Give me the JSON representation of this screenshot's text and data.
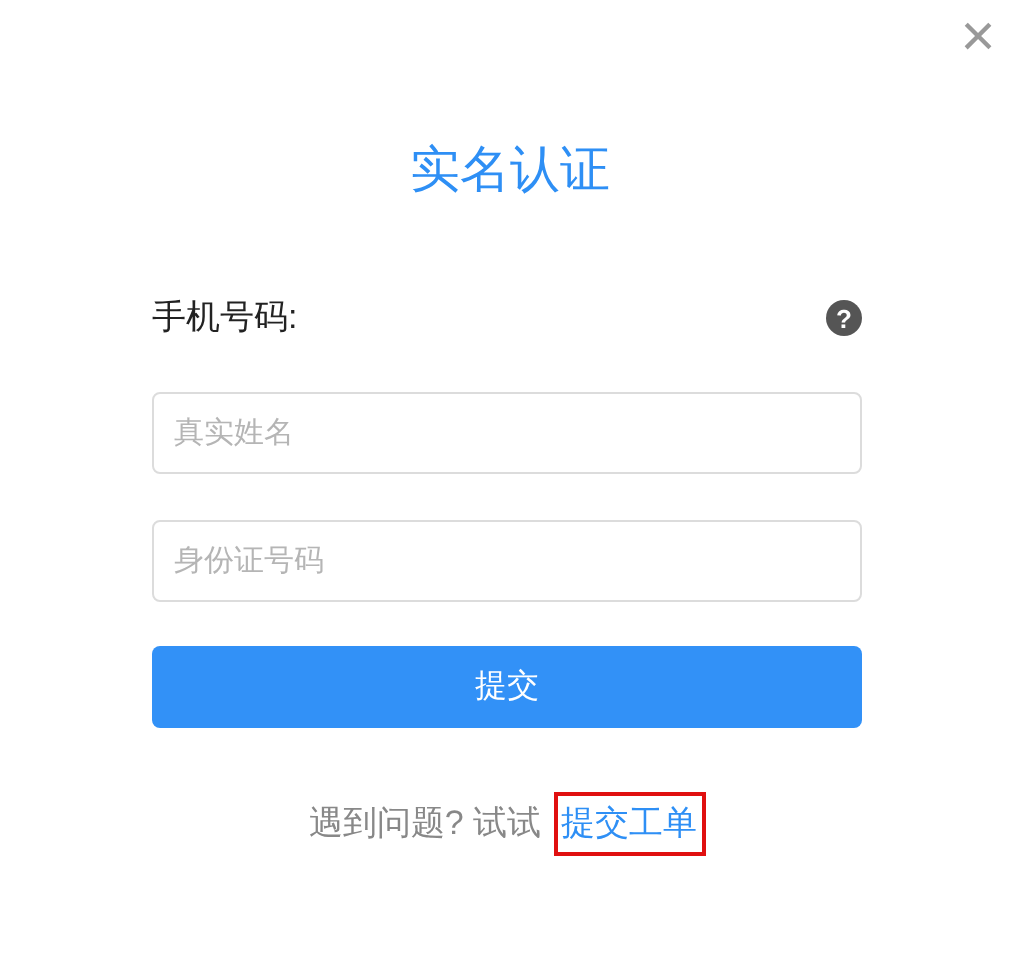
{
  "close_button": {
    "label": "×"
  },
  "title": "实名认证",
  "phone_label": "手机号码:",
  "help_icon": {
    "label": "?"
  },
  "fields": [
    {
      "placeholder": "真实姓名"
    },
    {
      "placeholder": "身份证号码"
    }
  ],
  "submit_button": "提交",
  "footer": {
    "text": "遇到问题? 试试",
    "link": "提交工单",
    "link_highlighted": true
  }
}
